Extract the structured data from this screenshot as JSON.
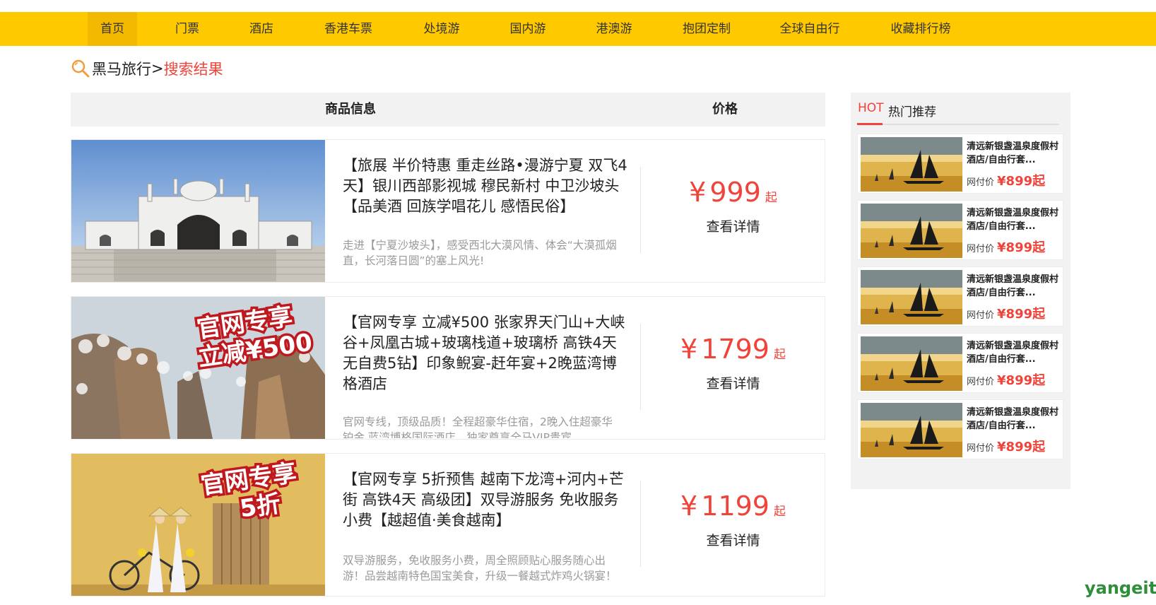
{
  "nav": {
    "items": [
      "首页",
      "门票",
      "酒店",
      "香港车票",
      "处境游",
      "国内游",
      "港澳游",
      "抱团定制",
      "全球自由行",
      "收藏排行榜"
    ],
    "active_index": 0,
    "bg_color": "#ffc900"
  },
  "breadcrumb": {
    "home": "黑马旅行",
    "separator": ">",
    "current": "搜索结果"
  },
  "results_header": {
    "info": "商品信息",
    "price": "价格"
  },
  "products": [
    {
      "title": "【旅展 半价特惠 重走丝路•漫游宁夏 双飞4天】银川西部影视城 穆民新村 中卫沙坡头【品美酒 回族学唱花儿 感悟民俗】",
      "desc": "走进【宁夏沙坡头】，感受西北大漠风情、体会“大漠孤烟直，长河落日圆”的塞上风光!",
      "currency": "¥",
      "price": "999",
      "price_suffix": "起",
      "detail": "查看详情",
      "image": "mosque-photo"
    },
    {
      "title": "【官网专享 立减¥500 张家界天门山+大峡谷+凤凰古城+玻璃栈道+玻璃桥 高铁4天 无自费5钻】印象鲵宴-赶年宴+2晚蓝湾博格酒店",
      "desc": "官网专线，顶级品质！全程超豪华住宿，2晚入住超豪华铂金 蓝湾博格国际酒店，独家尊享全马VIP贵宾",
      "currency": "¥",
      "price": "1799",
      "price_suffix": "起",
      "detail": "查看详情",
      "image": "snowy-mountain-photo",
      "badge": [
        "官网专享",
        "立减¥500"
      ]
    },
    {
      "title": "【官网专享 5折预售 越南下龙湾+河内+芒街 高铁4天 高级团】双导游服务 免收服务小费【越超值·美食越南】",
      "desc": "双导游服务，免收服务小费，周全照顾贴心服务随心出游！品尝越南特色国宝美食，升级一餐越式炸鸡火锅宴！",
      "currency": "¥",
      "price": "1199",
      "price_suffix": "起",
      "detail": "查看详情",
      "image": "vietnam-ladies-photo",
      "badge": [
        "官网专享",
        "5折"
      ]
    }
  ],
  "sidebar": {
    "hot_label": "HOT",
    "title": "热门推荐",
    "items": [
      {
        "name": "清远新银盏温泉度假村酒店/自由行套...",
        "price_label": "网付价",
        "price": "¥899起"
      },
      {
        "name": "清远新银盏温泉度假村酒店/自由行套...",
        "price_label": "网付价",
        "price": "¥899起"
      },
      {
        "name": "清远新银盏温泉度假村酒店/自由行套...",
        "price_label": "网付价",
        "price": "¥899起"
      },
      {
        "name": "清远新银盏温泉度假村酒店/自由行套...",
        "price_label": "网付价",
        "price": "¥899起"
      },
      {
        "name": "清远新银盏温泉度假村酒店/自由行套...",
        "price_label": "网付价",
        "price": "¥899起"
      }
    ]
  },
  "watermark": "yangeit",
  "colors": {
    "accent_red": "#f0433a",
    "nav_yellow": "#ffc900"
  }
}
